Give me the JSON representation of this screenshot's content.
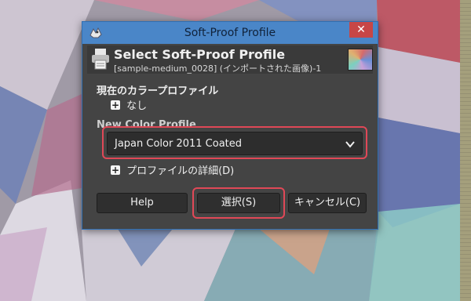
{
  "window": {
    "title": "Soft-Proof Profile",
    "close_glyph": "✕"
  },
  "header": {
    "title": "Select Soft-Proof Profile",
    "subtitle": "[sample-medium_0028] (インポートされた画像)-1"
  },
  "current_profile": {
    "label": "現在のカラープロファイル",
    "expander_glyph": "+",
    "value": "なし"
  },
  "new_profile": {
    "label": "New Color Profile",
    "selected": "Japan Color 2011 Coated"
  },
  "details": {
    "expander_glyph": "+",
    "label": "プロファイルの詳細(D)"
  },
  "buttons": {
    "help": "Help",
    "select": "選択(S)",
    "cancel": "キャンセル(C)"
  },
  "icons": {
    "app": "gimp-wilber-icon",
    "profile": "printer-profile-icon",
    "thumbnail": "image-thumbnail",
    "dropdown": "chevron-down-icon"
  },
  "colors": {
    "titlebar": "#4a86c8",
    "dialog_bg": "#444444",
    "close_button": "#c74646",
    "highlight": "#e04857"
  }
}
